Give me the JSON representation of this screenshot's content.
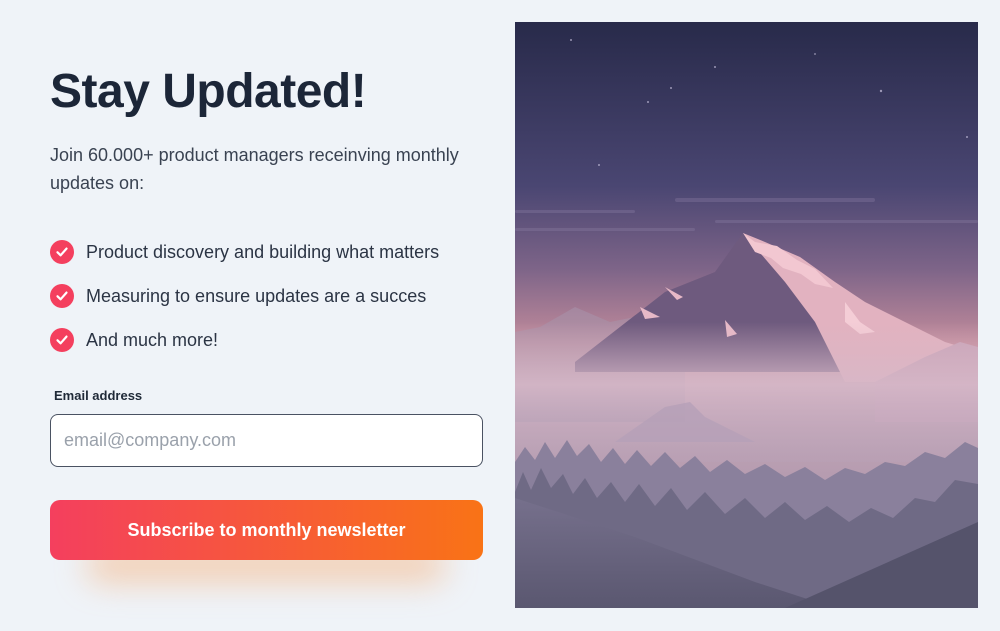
{
  "header": {
    "title": "Stay Updated!",
    "intro": "Join 60.000+ product managers receinving monthly updates on:"
  },
  "features": [
    {
      "label": "Product discovery and building what matters",
      "icon": "check-circle-icon"
    },
    {
      "label": "Measuring to ensure updates are a succes",
      "icon": "check-circle-icon"
    },
    {
      "label": "And much more!",
      "icon": "check-circle-icon"
    }
  ],
  "form": {
    "email_label": "Email address",
    "email_value": "",
    "email_placeholder": "email@company.com",
    "submit_label": "Subscribe to monthly newsletter"
  },
  "colors": {
    "accent_start": "#f43f5e",
    "accent_end": "#f97316",
    "title": "#1c2638",
    "background": "#eff3f8"
  },
  "hero_image": {
    "icon": "mountain-night-illustration"
  }
}
